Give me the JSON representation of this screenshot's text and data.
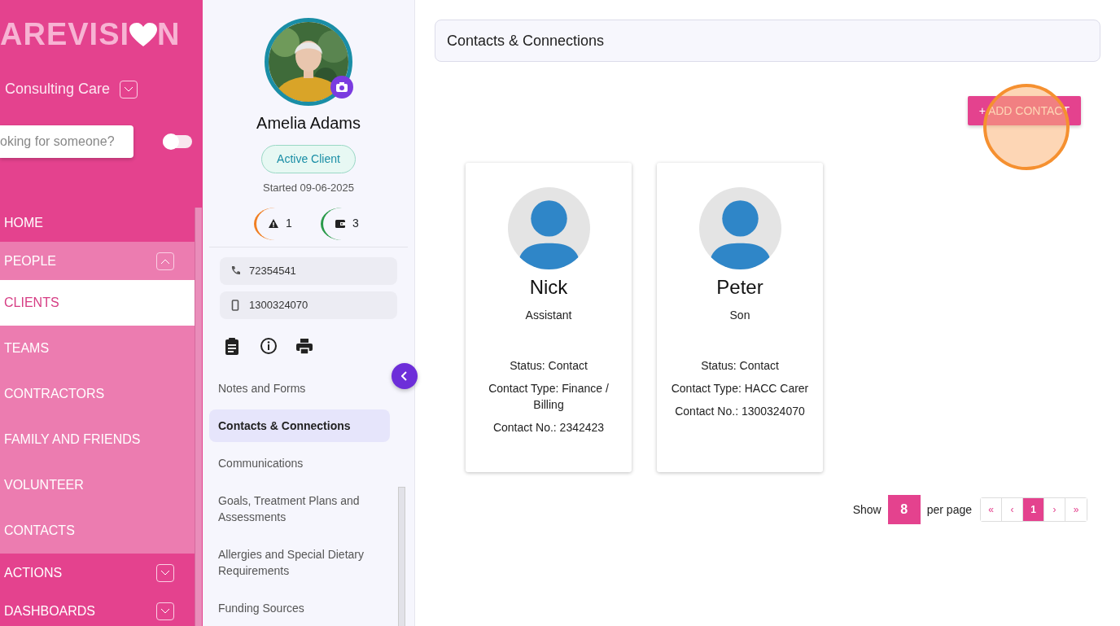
{
  "sidebar": {
    "logo": {
      "start": "AREVISI",
      "end": "N"
    },
    "organization": "Consulting Care",
    "search": {
      "placeholder": "oking for someone?"
    },
    "toggle": {
      "on": false
    },
    "nav": [
      {
        "label": "HOME",
        "kind": "link"
      },
      {
        "label": "PEOPLE",
        "kind": "group",
        "expanded": true,
        "children": [
          {
            "label": "CLIENTS",
            "selected": true
          },
          {
            "label": "TEAMS",
            "selected": false
          },
          {
            "label": "CONTRACTORS",
            "selected": false
          },
          {
            "label": "FAMILY AND FRIENDS",
            "selected": false
          },
          {
            "label": "VOLUNTEER",
            "selected": false
          },
          {
            "label": "CONTACTS",
            "selected": false
          }
        ]
      },
      {
        "label": "ACTIONS",
        "kind": "group",
        "expanded": false
      },
      {
        "label": "DASHBOARDS",
        "kind": "group",
        "expanded": false
      }
    ]
  },
  "client": {
    "name": "Amelia Adams",
    "status": "Active Client",
    "started": "Started 09-06-2025",
    "badges": [
      {
        "kind": "alert",
        "count": "1",
        "color": "#f07f23"
      },
      {
        "kind": "wallet",
        "count": "3",
        "color": "#2a9a4a"
      }
    ],
    "phones": [
      {
        "kind": "phone",
        "number": "72354541"
      },
      {
        "kind": "mobile",
        "number": "1300324070"
      }
    ],
    "actions": [
      {
        "kind": "clipboard"
      },
      {
        "kind": "info"
      },
      {
        "kind": "print"
      }
    ],
    "menu": [
      {
        "label": "Notes and Forms",
        "selected": false
      },
      {
        "label": "Contacts & Connections",
        "selected": true
      },
      {
        "label": "Communications",
        "selected": false
      },
      {
        "label": "Goals, Treatment Plans and Assessments",
        "selected": false
      },
      {
        "label": "Allergies and Special Dietary Requirements",
        "selected": false
      },
      {
        "label": "Funding Sources",
        "selected": false
      }
    ]
  },
  "main": {
    "title": "Contacts & Connections",
    "add_button": {
      "label": "+ ADD CONTACT",
      "highlighted": true
    },
    "contacts": [
      {
        "name": "Nick",
        "relation": "Assistant",
        "status": "Status: Contact",
        "contact_type": "Contact Type: Finance / Billing",
        "contact_no": "Contact No.: 2342423"
      },
      {
        "name": "Peter",
        "relation": "Son",
        "status": "Status: Contact",
        "contact_type": "Contact Type: HACC Carer",
        "contact_no": "Contact No.: 1300324070"
      }
    ],
    "pagination": {
      "show_label": "Show",
      "per_page": "8",
      "per_page_label": "per page",
      "pages": [
        {
          "label": "«",
          "selected": false
        },
        {
          "label": "‹",
          "selected": false
        },
        {
          "label": "1",
          "selected": true
        },
        {
          "label": "›",
          "selected": false
        },
        {
          "label": "»",
          "selected": false
        }
      ]
    }
  }
}
